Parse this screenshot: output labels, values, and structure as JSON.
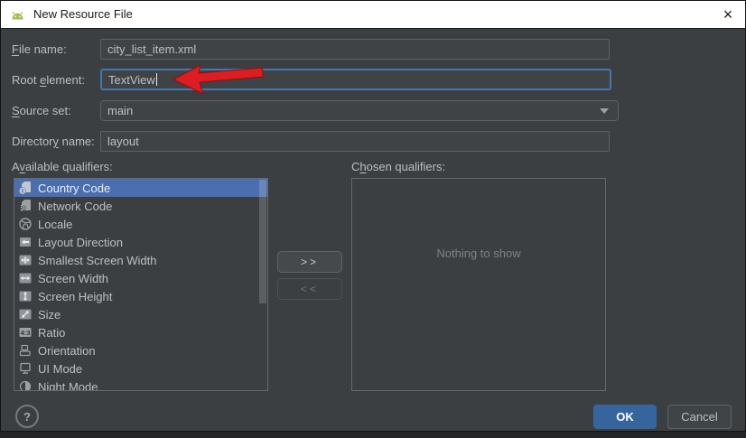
{
  "window": {
    "title": "New Resource File",
    "close_glyph": "×"
  },
  "form": {
    "file_name": {
      "label_pre": "",
      "label_mn": "F",
      "label_post": "ile name:",
      "value": "city_list_item.xml"
    },
    "root_element": {
      "label_pre": "Root ",
      "label_mn": "e",
      "label_post": "lement:",
      "value": "TextView"
    },
    "source_set": {
      "label_pre": "",
      "label_mn": "S",
      "label_post": "ource set:",
      "value": "main"
    },
    "directory_name": {
      "label_pre": "Director",
      "label_mn": "y",
      "label_post": " name:",
      "value": "layout"
    }
  },
  "qualifiers": {
    "available_label": {
      "pre": "A",
      "mn": "v",
      "post": "ailable qualifiers:"
    },
    "chosen_label": {
      "pre": "C",
      "mn": "h",
      "post": "osen qualifiers:"
    },
    "available": [
      {
        "label": "Country Code",
        "icon": "country-code-icon",
        "selected": true
      },
      {
        "label": "Network Code",
        "icon": "network-code-icon"
      },
      {
        "label": "Locale",
        "icon": "locale-icon"
      },
      {
        "label": "Layout Direction",
        "icon": "layout-direction-icon"
      },
      {
        "label": "Smallest Screen Width",
        "icon": "smallest-screen-width-icon"
      },
      {
        "label": "Screen Width",
        "icon": "screen-width-icon"
      },
      {
        "label": "Screen Height",
        "icon": "screen-height-icon"
      },
      {
        "label": "Size",
        "icon": "size-icon"
      },
      {
        "label": "Ratio",
        "icon": "ratio-icon"
      },
      {
        "label": "Orientation",
        "icon": "orientation-icon"
      },
      {
        "label": "UI Mode",
        "icon": "ui-mode-icon"
      },
      {
        "label": "Night Mode",
        "icon": "night-mode-icon"
      }
    ],
    "chosen_empty": "Nothing to show",
    "add_button": ">>",
    "remove_button": "<<"
  },
  "footer": {
    "help": "?",
    "ok": "OK",
    "cancel": "Cancel"
  },
  "colors": {
    "selection": "#4b6eaf",
    "ok_button": "#36649c",
    "focus_ring": "#4178ad",
    "annotation_arrow": "#dc1d22",
    "android_green": "#a2c04d"
  }
}
